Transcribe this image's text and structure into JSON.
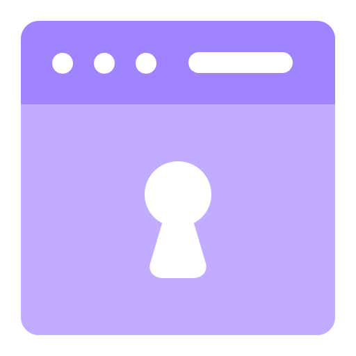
{
  "icon": {
    "name": "secure-browser-lock-icon",
    "colors": {
      "background": "#ffffff",
      "window_body": "#c2acff",
      "title_bar": "#a084ff",
      "foreground": "#ffffff"
    },
    "parts": {
      "window_dots_icon": "window-control-dots",
      "address_bar_icon": "address-bar",
      "keyhole_icon": "keyhole"
    }
  }
}
